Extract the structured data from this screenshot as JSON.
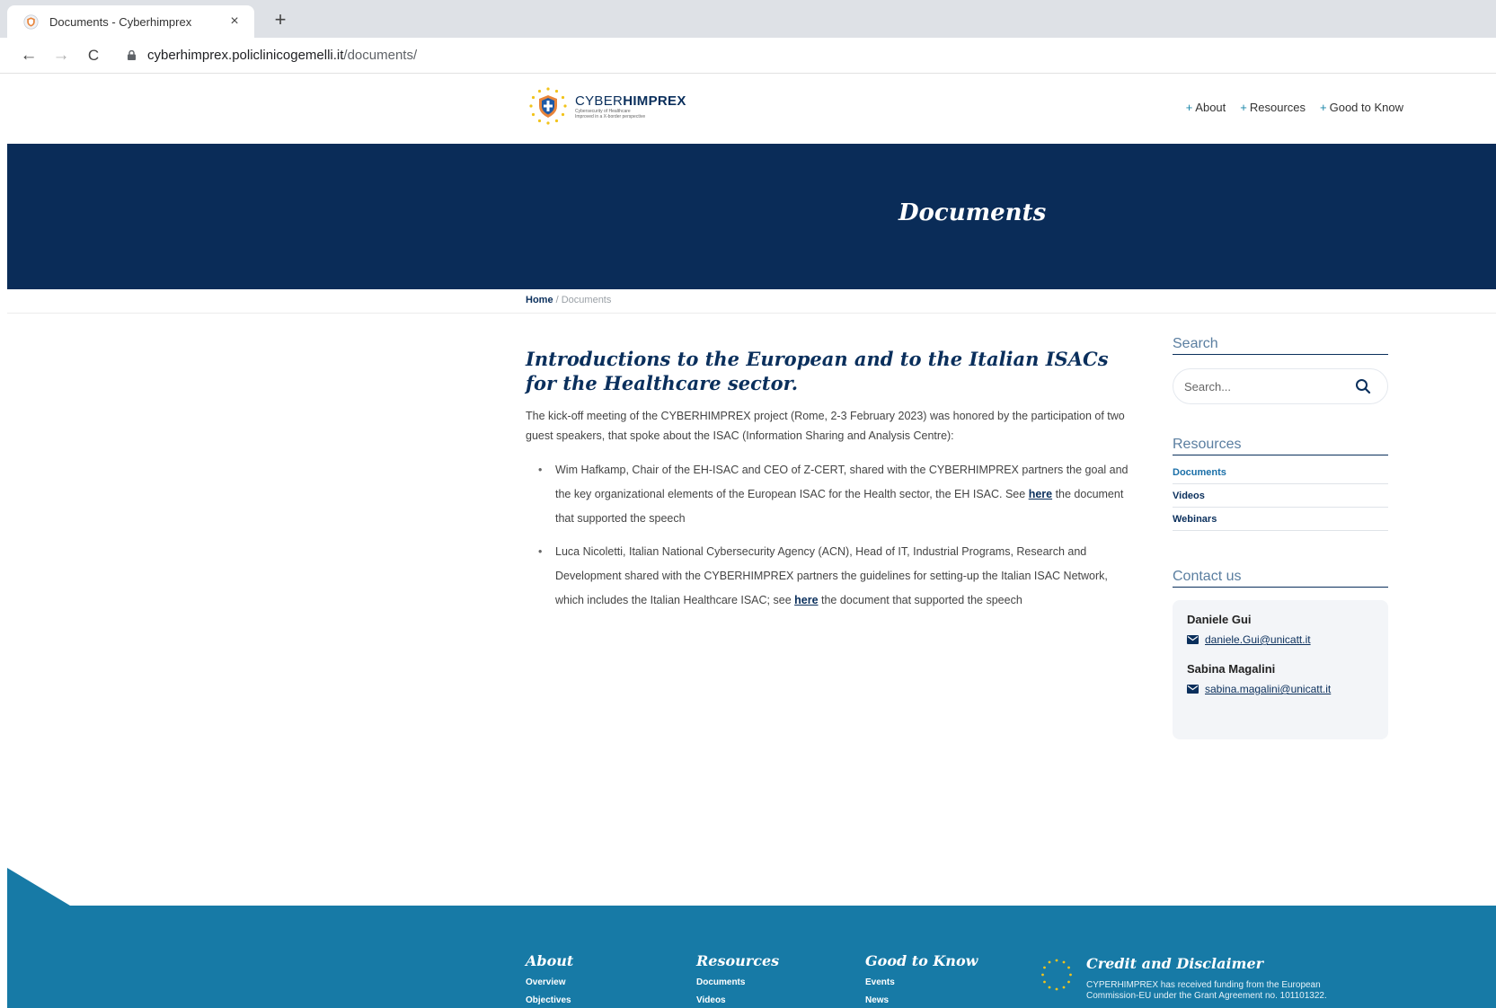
{
  "browser": {
    "tab_title": "Documents - Cyberhimprex",
    "close_glyph": "×",
    "new_tab_glyph": "+",
    "back_glyph": "←",
    "forward_glyph": "→",
    "reload_glyph": "C",
    "url_host": "cyberhimprex.policlinicogemelli.it",
    "url_path": "/documents/"
  },
  "header": {
    "logo_name_light": "CYBER",
    "logo_name_bold": "HIMPREX",
    "logo_tagline_1": "Cybersecurity of Healthcare",
    "logo_tagline_2": "Improved in a X-border perspective",
    "nav": [
      {
        "plus": "+",
        "label": "About"
      },
      {
        "plus": "+",
        "label": "Resources"
      },
      {
        "plus": "+",
        "label": "Good to Know"
      }
    ]
  },
  "hero": {
    "title": "Documents"
  },
  "breadcrumb": {
    "home": "Home",
    "separator": " / ",
    "current": "Documents"
  },
  "article": {
    "title": "Introductions to the European and to the Italian ISACs for the Healthcare sector.",
    "intro": "The kick-off meeting of the CYBERHIMPREX project (Rome, 2-3 February 2023) was honored by the participation of two guest speakers, that spoke about the ISAC (Information Sharing and Analysis Centre):",
    "bullets": [
      {
        "before": "Wim Hafkamp, Chair of the EH-ISAC and CEO of Z-CERT, shared with the CYBERHIMPREX partners the goal and the key organizational elements of the European ISAC for the Health sector, the EH ISAC. See ",
        "link": "here",
        "after": " the document that supported the speech"
      },
      {
        "before": "Luca Nicoletti, Italian National Cybersecurity Agency (ACN), Head of IT, Industrial Programs, Research and Development shared with the CYBERHIMPREX partners the guidelines for setting-up the Italian ISAC Network, which includes the Italian Healthcare ISAC; see ",
        "link": "here",
        "after": " the document that supported the speech"
      }
    ]
  },
  "sidebar": {
    "search_heading": "Search",
    "search_placeholder": "Search...",
    "resources_heading": "Resources",
    "resources": [
      "Documents",
      "Videos",
      "Webinars"
    ],
    "contact_heading": "Contact us",
    "contacts": [
      {
        "name": "Daniele Gui",
        "email": "daniele.Gui@unicatt.it"
      },
      {
        "name": "Sabina Magalini",
        "email": "sabina.magalini@unicatt.it"
      }
    ]
  },
  "footer": {
    "about": {
      "title": "About",
      "items": [
        "Overview",
        "Objectives"
      ]
    },
    "resources": {
      "title": "Resources",
      "items": [
        "Documents",
        "Videos"
      ]
    },
    "good_to_know": {
      "title": "Good to Know",
      "items": [
        "Events",
        "News"
      ]
    },
    "credit_title": "Credit and Disclaimer",
    "credit_text": "CYPERHIMPREX has received funding from the European Commission-EU under the Grant Agreement no. 101101322."
  },
  "colors": {
    "navy": "#0a2c58",
    "footer_blue": "#177aa6",
    "accent": "#1a86a8"
  }
}
